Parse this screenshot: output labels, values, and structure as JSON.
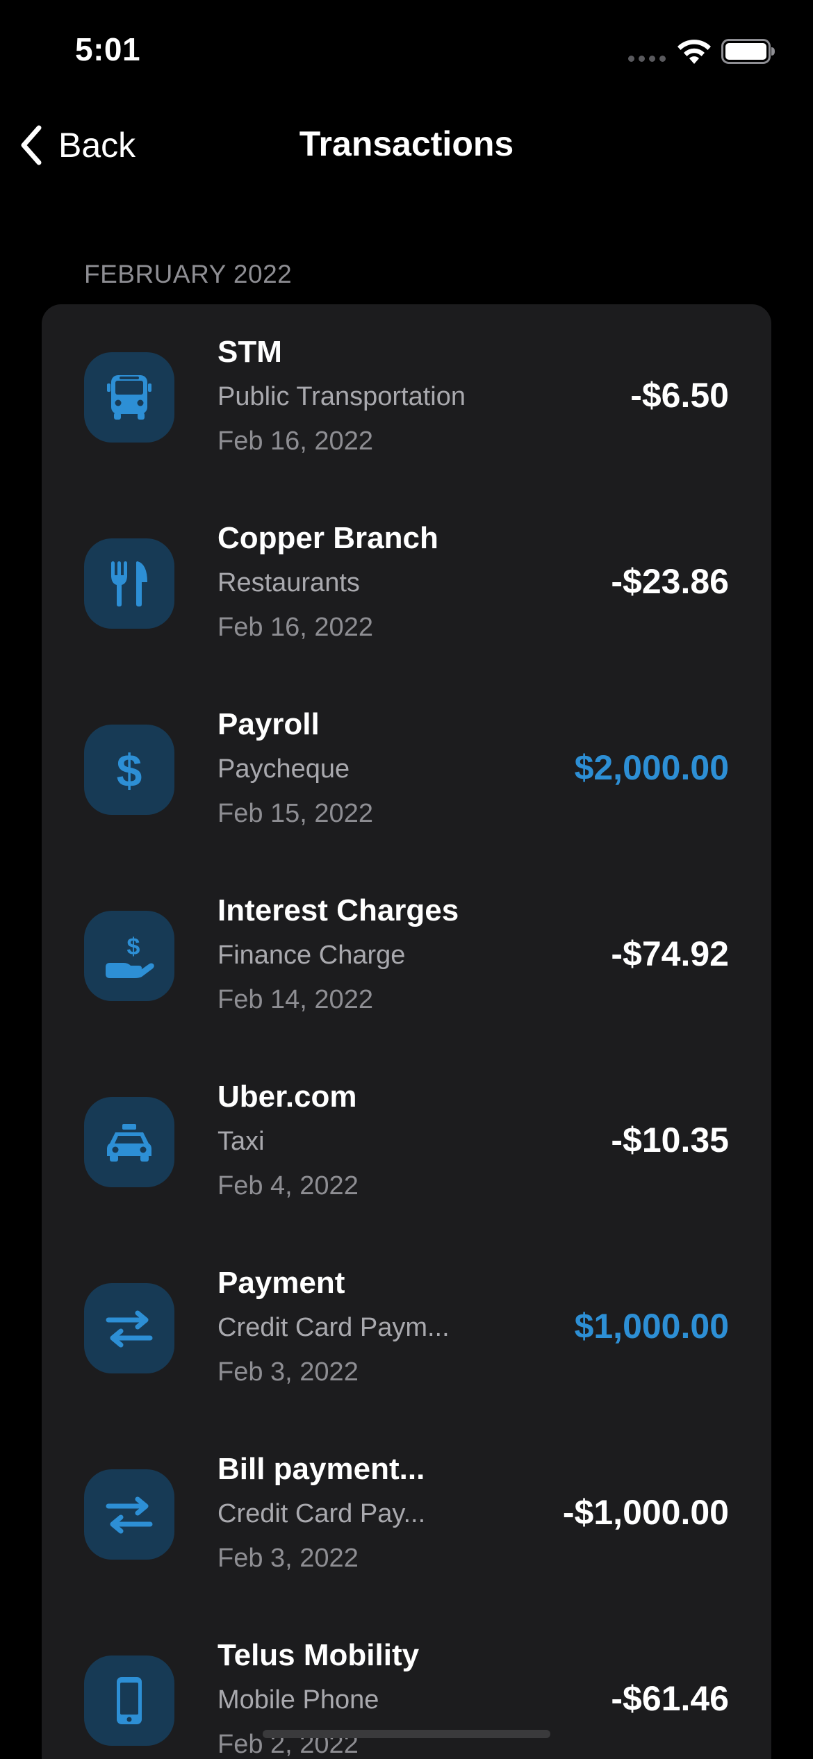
{
  "status_bar": {
    "time": "5:01"
  },
  "nav": {
    "back_label": "Back",
    "title": "Transactions"
  },
  "section": {
    "header": "FEBRUARY 2022"
  },
  "colors": {
    "accent": "#2d8fd5",
    "icon_bg": "#173a55",
    "card_bg": "#1c1c1e"
  },
  "transactions": [
    {
      "name": "STM",
      "category": "Public Transportation",
      "date": "Feb 16, 2022",
      "amount": "-$6.50",
      "icon": "bus-icon",
      "credit": false
    },
    {
      "name": "Copper Branch",
      "category": "Restaurants",
      "date": "Feb 16, 2022",
      "amount": "-$23.86",
      "icon": "fork-knife-icon",
      "credit": false
    },
    {
      "name": "Payroll",
      "category": "Paycheque",
      "date": "Feb 15, 2022",
      "amount": "$2,000.00",
      "icon": "dollar-sign-icon",
      "credit": true
    },
    {
      "name": "Interest Charges",
      "category": "Finance Charge",
      "date": "Feb 14, 2022",
      "amount": "-$74.92",
      "icon": "hand-dollar-icon",
      "credit": false
    },
    {
      "name": "Uber.com",
      "category": "Taxi",
      "date": "Feb 4, 2022",
      "amount": "-$10.35",
      "icon": "taxi-icon",
      "credit": false
    },
    {
      "name": "Payment",
      "category": "Credit Card Paym...",
      "date": "Feb 3, 2022",
      "amount": "$1,000.00",
      "icon": "transfer-arrows-icon",
      "credit": true
    },
    {
      "name": "Bill payment...",
      "category": "Credit Card Pay...",
      "date": "Feb 3, 2022",
      "amount": "-$1,000.00",
      "icon": "transfer-arrows-icon",
      "credit": false
    },
    {
      "name": "Telus Mobility",
      "category": "Mobile Phone",
      "date": "Feb 2, 2022",
      "amount": "-$61.46",
      "icon": "mobile-phone-icon",
      "credit": false
    }
  ]
}
